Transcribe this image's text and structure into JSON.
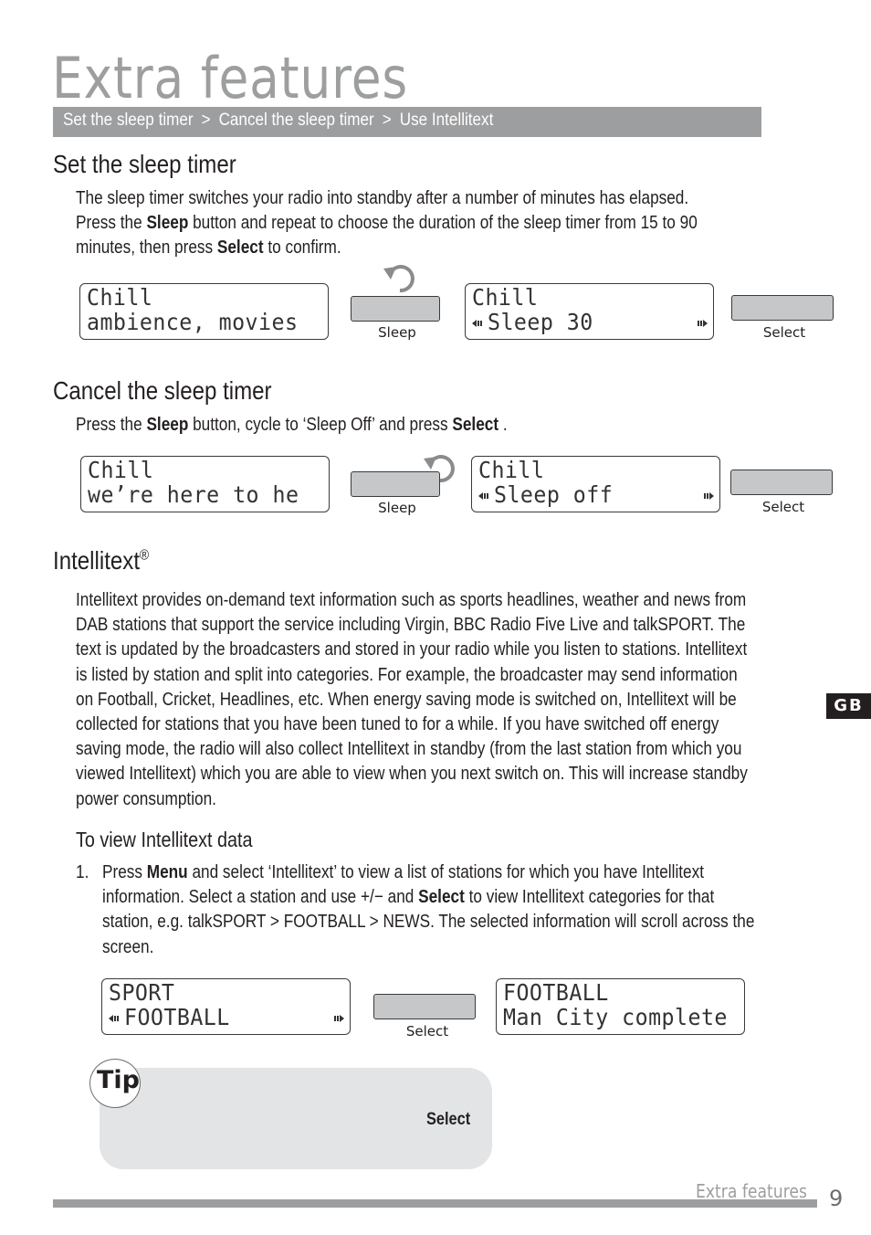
{
  "header": {
    "title": "Extra features",
    "breadcrumb": [
      "Set the sleep timer",
      "Cancel the sleep timer",
      "Use Intellitext"
    ],
    "breadcrumb_separator": ">"
  },
  "sections": {
    "set_sleep": {
      "heading": "Set the sleep timer",
      "lines": [
        [
          "The sleep timer switches your radio into standby after a number of minutes has elapsed."
        ],
        [
          "Press the ",
          "Sleep",
          " button and repeat to choose the duration of the sleep timer from 15 to 90"
        ],
        [
          "minutes, then press ",
          "Select",
          " to confirm."
        ]
      ],
      "display1": {
        "line1": "Chill",
        "line2": "ambience, movies"
      },
      "button1_label": "Sleep",
      "display2": {
        "line1": "Chill",
        "line2": "Sleep 30"
      },
      "button2_label": "Select"
    },
    "cancel_sleep": {
      "heading": "Cancel the sleep timer",
      "line": [
        "Press the ",
        "Sleep",
        " button, cycle to ‘Sleep Off’ and press ",
        "Select",
        " ."
      ],
      "display1": {
        "line1": "Chill",
        "line2": "we’re here to he"
      },
      "button1_label": "Sleep",
      "display2": {
        "line1": "Chill",
        "line2": "Sleep off"
      },
      "button2_label": "Select"
    },
    "intellitext": {
      "heading": "Intellitext",
      "heading_mark": "®",
      "lines": [
        "Intellitext provides on-demand text information such as sports headlines, weather and news from",
        "DAB stations that support the service including Virgin, BBC Radio Five Live and talkSPORT. The",
        "text is updated by the broadcasters and stored in your radio while you listen to stations. Intellitext",
        "is listed by station and split into categories. For example, the broadcaster may send information",
        "on Football, Cricket, Headlines, etc. When energy saving mode is switched on, Intellitext will be",
        "collected for stations that you have been tuned to for a while. If you have switched off energy",
        "saving mode, the radio will also collect Intellitext in standby (from the last station from which you",
        "viewed Intellitext) which you are able to view when you next switch on. This will increase standby",
        "power consumption."
      ],
      "subheading": "To view Intellitext data",
      "step_number": "1.",
      "step_lines": [
        [
          "Press ",
          "Menu",
          " and select ‘Intellitext’ to view a list of stations for which you have Intellitext"
        ],
        [
          "information. Select a station and use  +/−  and ",
          "Select",
          " to view Intellitext categories for that"
        ],
        [
          "station, e.g. talkSPORT > FOOTBALL > NEWS.  The selected information will scroll across the"
        ],
        [
          "screen."
        ]
      ],
      "display1": {
        "line1": "SPORT",
        "line2": "FOOTBALL"
      },
      "button_label": "Select",
      "display2": {
        "line1": "FOOTBALL",
        "line2": "Man City complete"
      }
    }
  },
  "tip": {
    "label": "Tip",
    "text": "Select"
  },
  "side_tab": "GB",
  "footer": {
    "section_label": "Extra features",
    "page_number": "9"
  }
}
